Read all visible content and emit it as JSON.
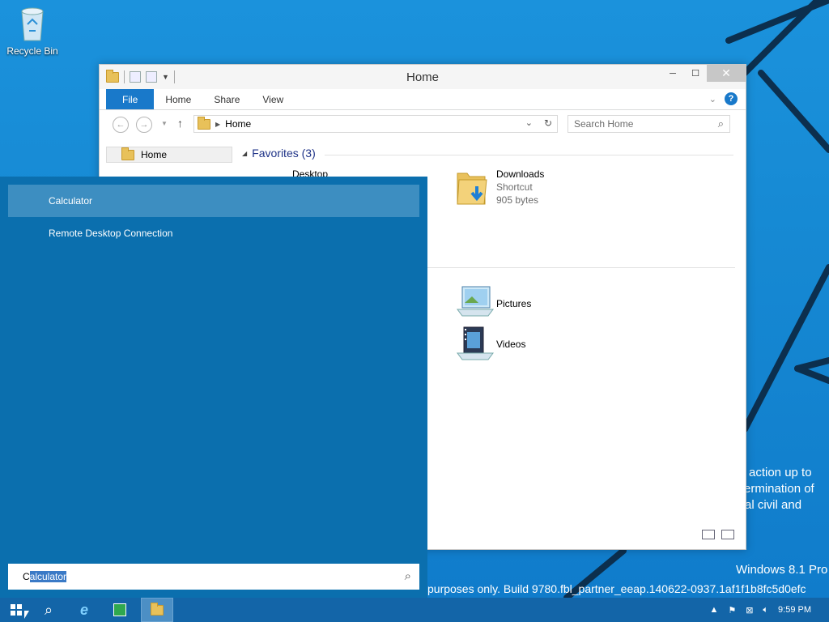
{
  "desktop": {
    "recycle_bin_label": "Recycle Bin",
    "watermark_lines": [
      "action up to",
      "ermination of",
      "al civil and"
    ],
    "os_label": "Windows 8.1 Pro",
    "build_text": "purposes only. Build 9780.fbl_partner_eeap.140622-0937.1af1f1b8fc5d0efc"
  },
  "explorer": {
    "title": "Home",
    "ribbon_tabs": [
      "File",
      "Home",
      "Share",
      "View"
    ],
    "address": "Home",
    "search_placeholder": "Search Home",
    "nav_item": "Home",
    "group_header": "Favorites (3)",
    "items": {
      "desktop": {
        "name": "Desktop"
      },
      "downloads": {
        "name": "Downloads",
        "type": "Shortcut",
        "size": "905 bytes"
      },
      "pictures": {
        "name": "Pictures"
      },
      "videos": {
        "name": "Videos"
      }
    }
  },
  "start_search": {
    "results": [
      "Calculator",
      "Remote Desktop Connection"
    ],
    "query_first_char": "C",
    "query_rest": "alculator"
  },
  "taskbar": {
    "clock": "9:59 PM"
  },
  "colors": {
    "accent": "#1979ca",
    "start_panel": "#0b6fae",
    "taskbar": "#1365a8"
  }
}
